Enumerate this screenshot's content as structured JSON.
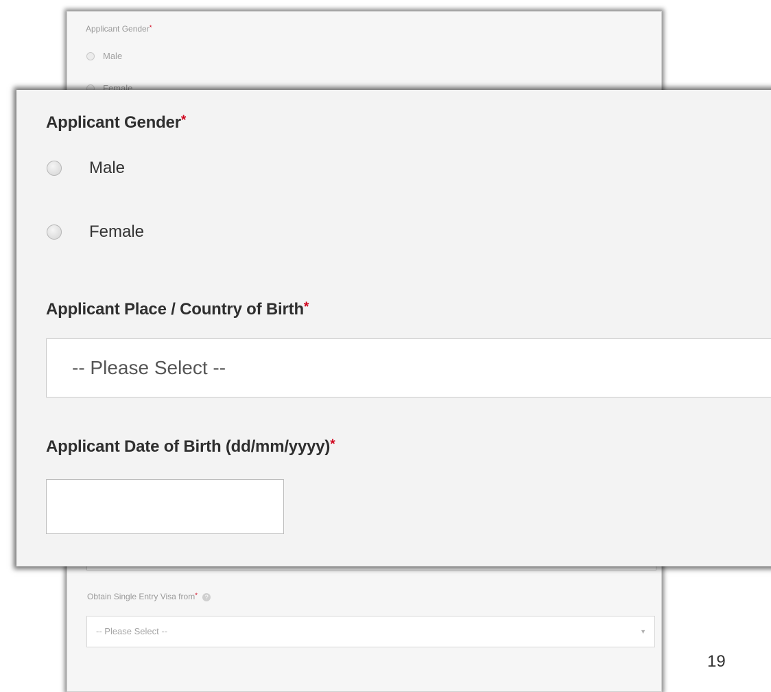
{
  "background_form": {
    "gender_label": "Applicant Gender",
    "required_mark": "*",
    "gender_options": [
      "Male",
      "Female"
    ],
    "visa_label": "Obtain Single Entry Visa from",
    "visa_help_icon": "help-icon",
    "visa_select_value": "-- Please Select --"
  },
  "zoomed_form": {
    "gender_label": "Applicant Gender",
    "gender_options": [
      "Male",
      "Female"
    ],
    "country_label": "Applicant Place / Country of Birth",
    "country_select_value": "-- Please Select --",
    "dob_label": "Applicant Date of Birth (dd/mm/yyyy)",
    "dob_value": "",
    "required_mark": "*"
  },
  "page_number": "19",
  "colors": {
    "required": "#d0021b",
    "panel_background": "#f3f3f3"
  }
}
